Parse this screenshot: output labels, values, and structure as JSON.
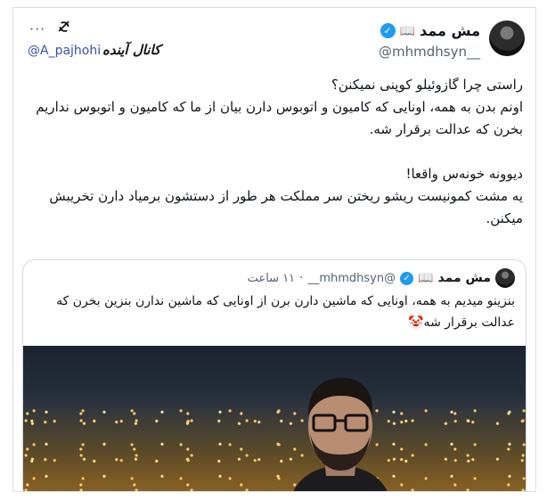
{
  "tweet": {
    "display_name": "مش ممد",
    "name_emoji": "📖",
    "handle": "@mhmdhsyn__",
    "more_label": "···",
    "lines": [
      "راستی چرا گازوئیلو کوپنی نمیکنن؟",
      "اونم بدن به همه، اونایی که کامیون و اتوبوس دارن بیان از ما که کامیون و اتوبوس نداریم بخرن که عدالت برقرار شه.",
      "",
      "دیوونه خونه‌س واقعا!",
      "یه مشت کمونیست ریشو ریختن سر مملکت هر طور از دستشون برمیاد دارن تخریبش میکنن."
    ]
  },
  "watermark": {
    "script": "کانال آینده",
    "handle": "@A_pajhohi"
  },
  "quote": {
    "display_name": "مش ممد",
    "name_emoji": "📖",
    "handle": "@mhmdhsyn__",
    "separator": "·",
    "time": "۱۱ ساعت",
    "text": "بنزینو میدیم به همه، اونایی که ماشین دارن برن از اونایی که ماشین ندارن بنزین بخرن که عدالت برقرار شه🤡"
  },
  "colors": {
    "verified": "#1d9bf0",
    "secondary_text": "#536471",
    "watermark_handle": "#3a52a8"
  },
  "icons": {
    "verified": "verified-badge-icon",
    "more": "more-horizontal-icon",
    "grok": "grok-icon"
  }
}
